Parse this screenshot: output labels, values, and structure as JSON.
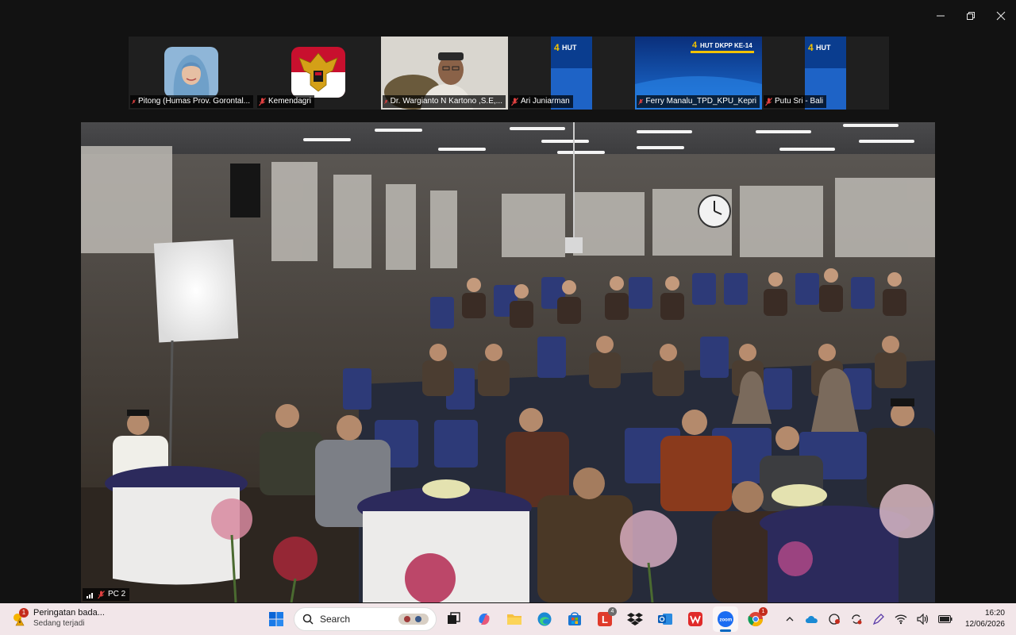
{
  "participants": [
    {
      "name": "Pitong (Humas Prov. Gorontal...",
      "kind": "avatar-hijab"
    },
    {
      "name": "Kemendagri",
      "kind": "avatar-garuda"
    },
    {
      "name": "Dr. Wargianto N Kartono ,S.E,...",
      "kind": "video-man"
    },
    {
      "name": "Ari Juniarman",
      "kind": "video-banner"
    },
    {
      "name": "Ferry Manalu_TPD_KPU_Kepri",
      "kind": "video-banner-full"
    },
    {
      "name": "Putu Sri - Bali",
      "kind": "video-banner"
    }
  ],
  "banner_text": "HUT DKPP KE-14",
  "banner_short": "HUT",
  "stage": {
    "label": "PC 2"
  },
  "taskbar": {
    "notification": {
      "badge": "1",
      "title": "Peringatan bada...",
      "subtitle": "Sedang terjadi"
    },
    "search_placeholder": "Search",
    "app_badges": {
      "office_letter": "4",
      "chrome": "1"
    },
    "time": "16:20",
    "date": "12/06/2026"
  },
  "colors": {
    "taskbar": "#f2e6e9",
    "strip": "#1f1f1f",
    "accent": "#0067c0"
  }
}
